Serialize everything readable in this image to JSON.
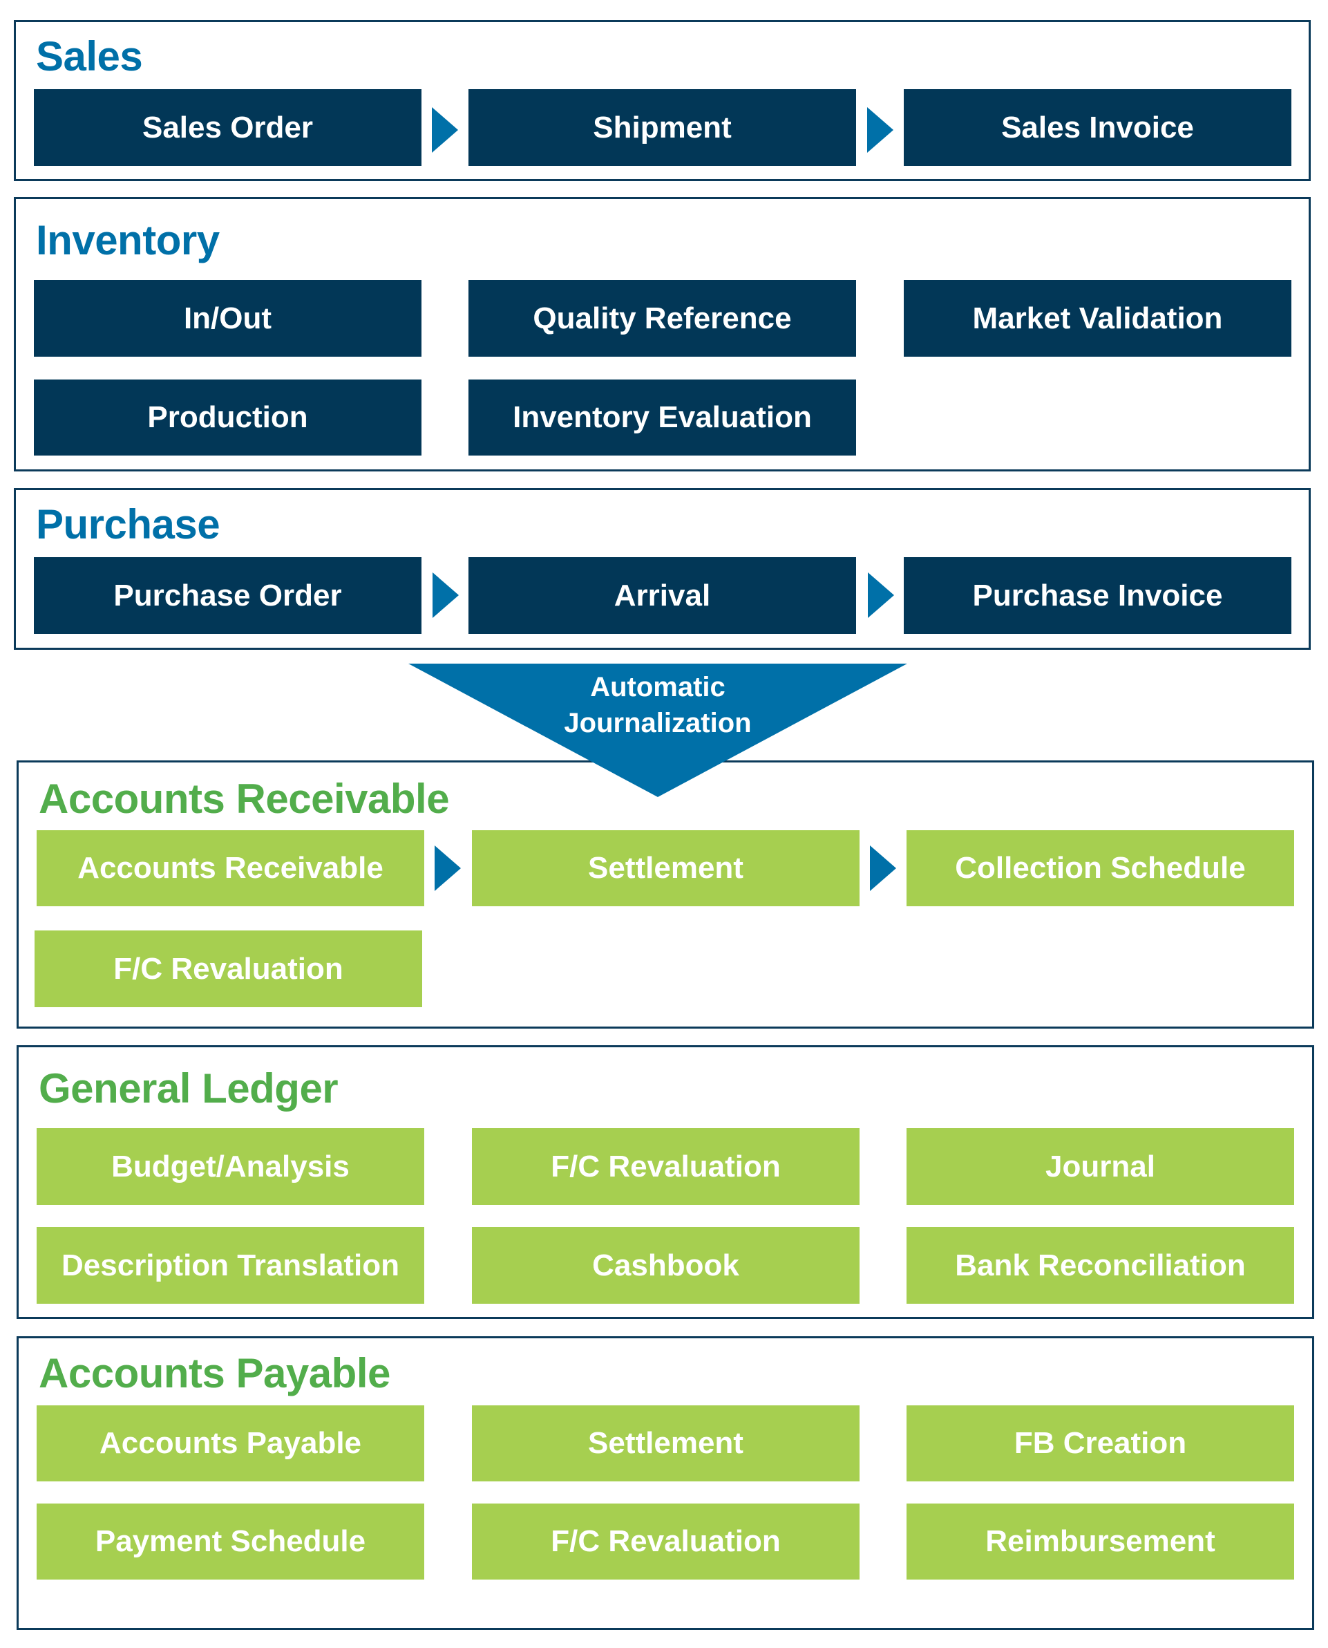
{
  "colors": {
    "navy_box": "#023757",
    "blue_accent": "#0070a8",
    "green_title": "#52ad4b",
    "lime_box": "#a6cf50",
    "border": "#0b3a5a"
  },
  "sales": {
    "title": "Sales",
    "flow": [
      "Sales Order",
      "Shipment",
      "Sales Invoice"
    ]
  },
  "inventory": {
    "title": "Inventory",
    "items": [
      "In/Out",
      "Quality Reference",
      "Market Validation",
      "Production",
      "Inventory Evaluation"
    ]
  },
  "purchase": {
    "title": "Purchase",
    "flow": [
      "Purchase Order",
      "Arrival",
      "Purchase Invoice"
    ]
  },
  "connector": {
    "line1": "Automatic",
    "line2": "Journalization"
  },
  "accounts_receivable": {
    "title": "Accounts Receivable",
    "flow": [
      "Accounts Receivable",
      "Settlement",
      "Collection Schedule"
    ],
    "items": [
      "F/C Revaluation"
    ]
  },
  "general_ledger": {
    "title": "General Ledger",
    "items": [
      "Budget/Analysis",
      "F/C Revaluation",
      "Journal",
      "Description Translation",
      "Cashbook",
      "Bank Reconciliation"
    ]
  },
  "accounts_payable": {
    "title": "Accounts Payable",
    "items": [
      "Accounts Payable",
      "Settlement",
      "FB Creation",
      "Payment Schedule",
      "F/C Revaluation",
      "Reimbursement"
    ]
  }
}
